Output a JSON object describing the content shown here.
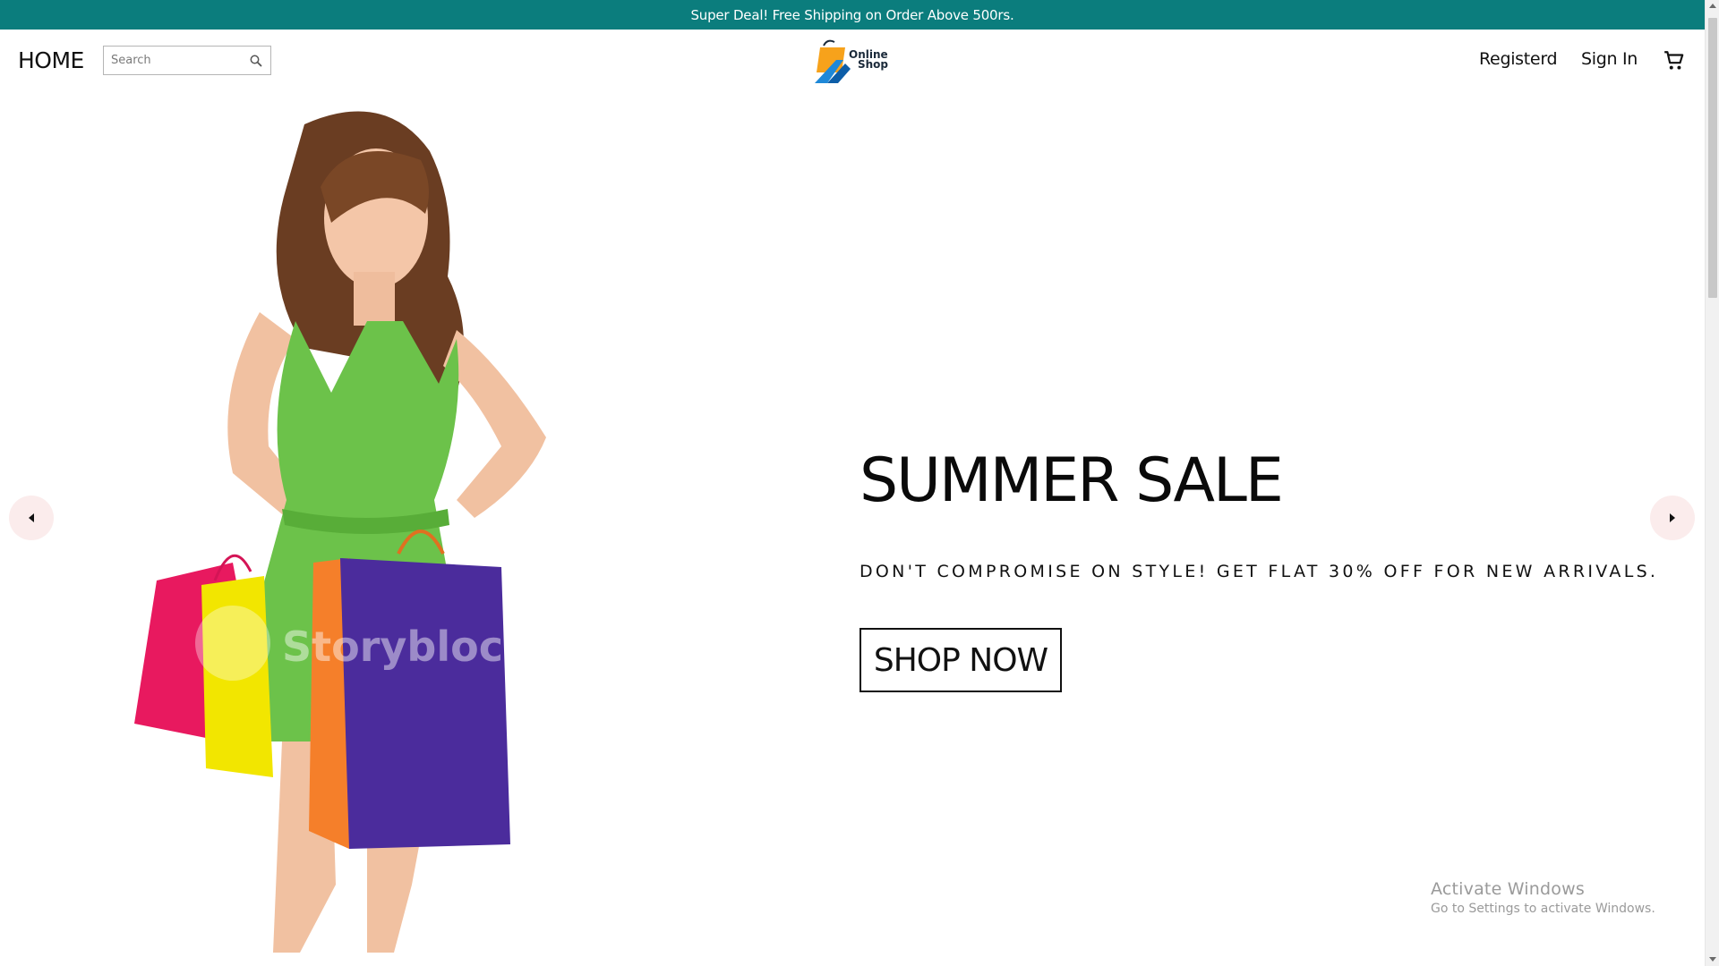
{
  "announcement": {
    "text": "Super Deal! Free Shipping on Order Above 500rs."
  },
  "nav": {
    "home_label": "HOME",
    "search_placeholder": "Search",
    "logo": {
      "line1": "Online",
      "line2": "Shop"
    },
    "registered_label": "Registerd",
    "signin_label": "Sign In",
    "cart_icon": "shopping-cart-icon"
  },
  "hero": {
    "title": "SUMMER SALE",
    "subtitle": "DON'T COMPROMISE ON STYLE! GET FLAT 30% OFF FOR NEW ARRIVALS.",
    "cta_label": "SHOP NOW",
    "image_watermark": "Storybloc",
    "prev_icon": "arrow-left-icon",
    "next_icon": "arrow-right-icon"
  },
  "os_watermark": {
    "title": "Activate Windows",
    "subtitle": "Go to Settings to activate Windows."
  },
  "colors": {
    "announcement_bg": "#0b7d7d",
    "arrow_bg": "#fbecec",
    "dress": "#6cc24a",
    "bag_pink": "#e8195f",
    "bag_yellow": "#f2e600",
    "bag_purple": "#4b2c9c",
    "bag_orange": "#f57f2a"
  }
}
